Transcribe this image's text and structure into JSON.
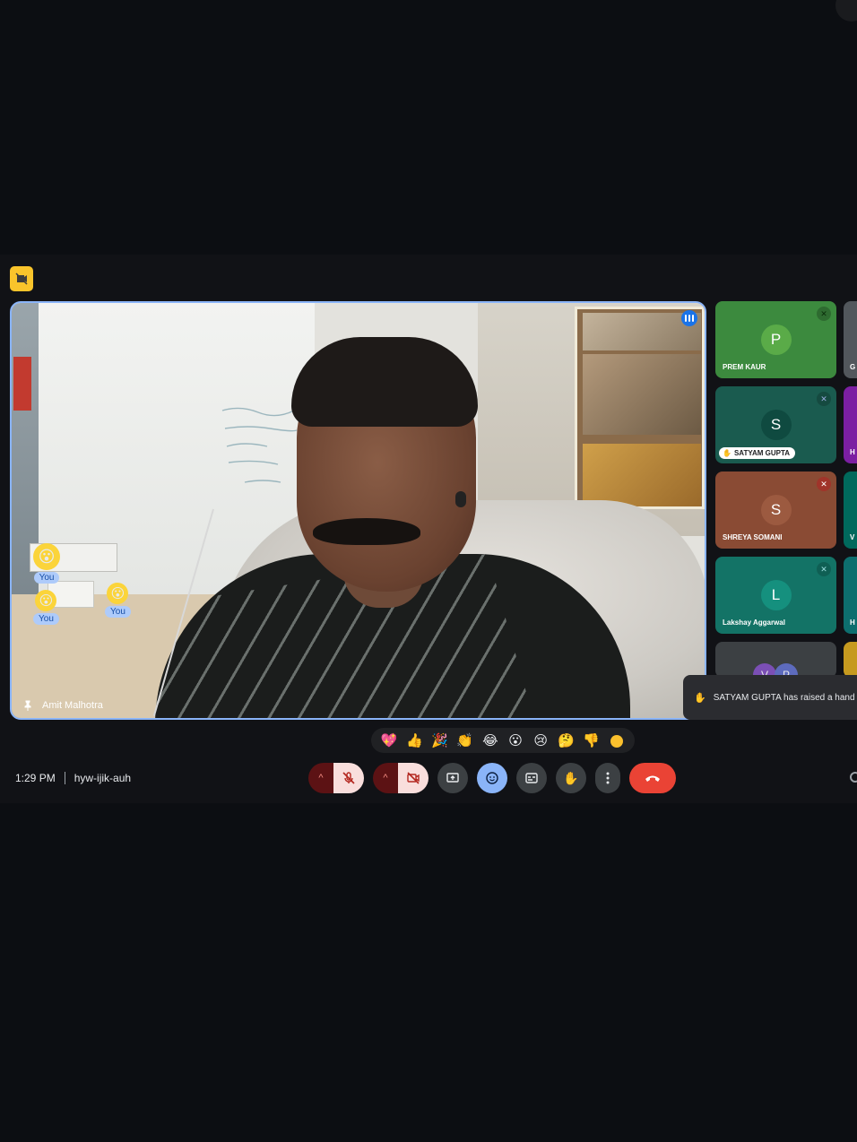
{
  "meeting": {
    "time": "1:29 PM",
    "code": "hyw-ijik-auh"
  },
  "main_tile": {
    "speaker_name": "Amit Malhotra",
    "reactions": [
      {
        "emoji": "😮",
        "label": "You"
      },
      {
        "emoji": "😮",
        "label": "You"
      },
      {
        "emoji": "😮",
        "label": "You"
      }
    ]
  },
  "participants": [
    {
      "initial": "P",
      "name": "PREM KAUR",
      "bg": "#3c8a3e",
      "avatar_bg": "#5aab48",
      "muted": true
    },
    {
      "initial": "S",
      "name": "SATYAM GUPTA",
      "bg": "#1a5b4f",
      "avatar_bg": "#0f4a40",
      "muted": true,
      "hand_raised": true
    },
    {
      "initial": "S",
      "name": "SHREYA SOMANI",
      "bg": "#8a4b34",
      "avatar_bg": "#9c5a40",
      "muted": true
    },
    {
      "initial": "L",
      "name": "Lakshay Aggarwal",
      "bg": "#137366",
      "avatar_bg": "#15907e",
      "muted": true
    }
  ],
  "next_tile_initials": [
    "V",
    "P"
  ],
  "edge_tiles": [
    {
      "label": "G",
      "bg": "#52575c"
    },
    {
      "label": "H",
      "bg": "#7b1fa2"
    },
    {
      "label": "V",
      "bg": "#00695c"
    },
    {
      "label": "H",
      "bg": "#0d6e6e"
    }
  ],
  "toast": {
    "text": "SATYAM GUPTA has raised a hand"
  },
  "reaction_bar": [
    "💖",
    "👍",
    "🎉",
    "👏",
    "😂",
    "😮",
    "😢",
    "🤔",
    "👎"
  ],
  "colors": {
    "accent": "#8ab4f8",
    "end_call": "#ea4335",
    "recording": "#f9c42b"
  }
}
